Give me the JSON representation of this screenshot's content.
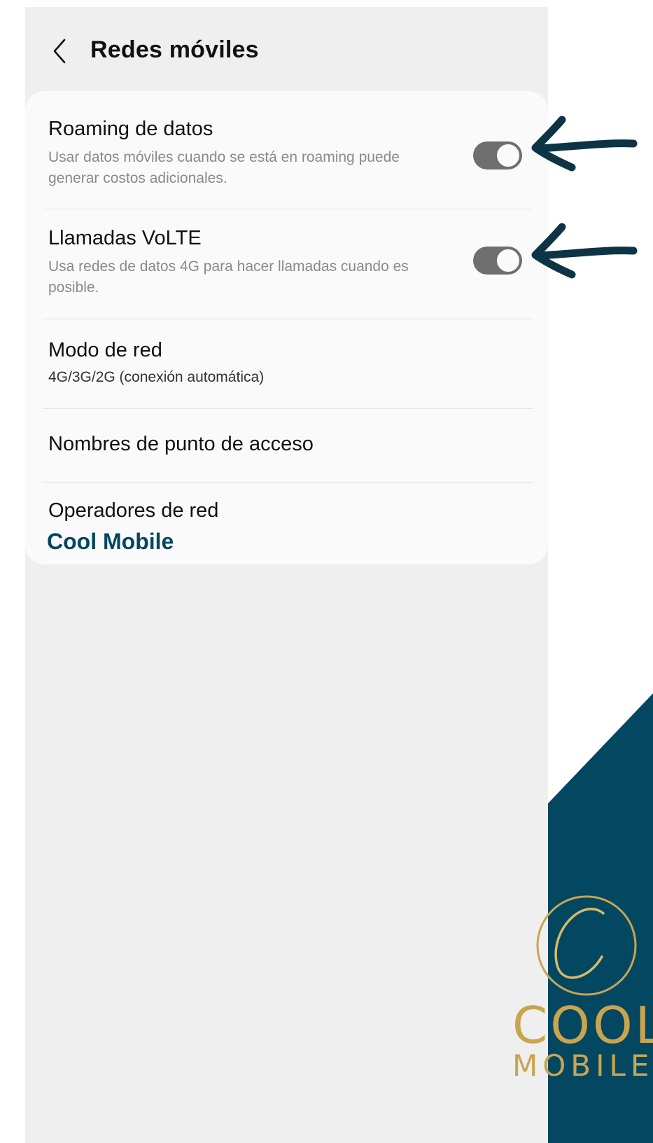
{
  "header": {
    "title": "Redes móviles"
  },
  "settings": {
    "items": [
      {
        "title": "Roaming de datos",
        "subtitle": "Usar datos móviles cuando se está en roaming puede generar costos adicionales."
      },
      {
        "title": "Llamadas VoLTE",
        "subtitle": "Usa redes de datos 4G para hacer llamadas cuando es posible."
      },
      {
        "title": "Modo de red",
        "subtitle": "4G/3G/2G (conexión automática)"
      },
      {
        "title": "Nombres de punto de acceso"
      },
      {
        "title": "Operadores de red",
        "subtitle": "Cool Mobile"
      }
    ]
  },
  "logo": {
    "line1": "COOL",
    "line2": "MOBILE"
  },
  "colors": {
    "brand_navy": "#034761",
    "brand_gold": "#c8a550",
    "arrow": "#0c3445"
  },
  "icons": [
    "back-chevron-icon",
    "arrow-left-icon"
  ]
}
